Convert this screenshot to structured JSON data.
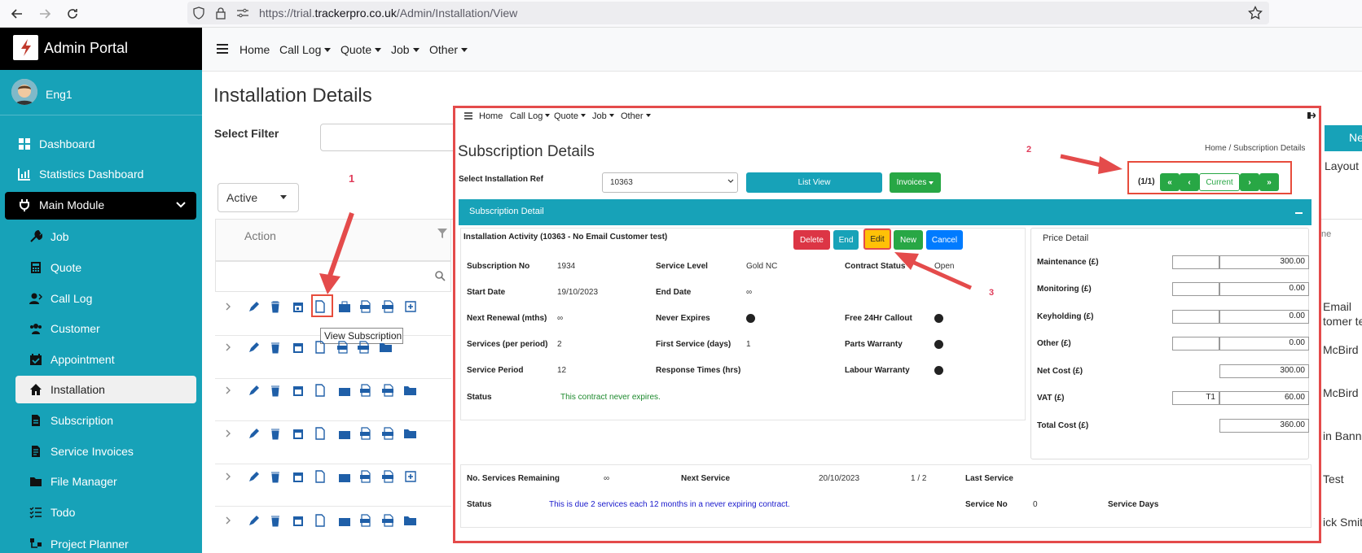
{
  "browser": {
    "url_prefix": "https://trial.",
    "url_domain": "trackerpro.co.uk",
    "url_path": "/Admin/Installation/View"
  },
  "sidebar": {
    "brand": "Admin Portal",
    "user": "Eng1",
    "items": [
      {
        "label": "Dashboard",
        "icon": "dashboard-icon"
      },
      {
        "label": "Statistics Dashboard",
        "icon": "statistics-icon"
      },
      {
        "label": "Main Module",
        "icon": "plug-icon"
      },
      {
        "label": "Job",
        "icon": "wrench-icon"
      },
      {
        "label": "Quote",
        "icon": "calculator-icon"
      },
      {
        "label": "Call Log",
        "icon": "user-phone-icon"
      },
      {
        "label": "Customer",
        "icon": "users-icon"
      },
      {
        "label": "Appointment",
        "icon": "calendar-check-icon"
      },
      {
        "label": "Installation",
        "icon": "home-icon"
      },
      {
        "label": "Subscription",
        "icon": "file-icon"
      },
      {
        "label": "Service Invoices",
        "icon": "invoice-icon"
      },
      {
        "label": "File Manager",
        "icon": "folder-icon"
      },
      {
        "label": "Todo",
        "icon": "list-icon"
      },
      {
        "label": "Project Planner",
        "icon": "planner-icon"
      }
    ]
  },
  "topnav": {
    "home": "Home",
    "call_log": "Call Log",
    "quote": "Quote",
    "job": "Job",
    "other": "Other"
  },
  "page": {
    "title": "Installation Details",
    "filter_label": "Select Filter",
    "active_filter": "Active",
    "action_header": "Action",
    "tooltip": "View Subscription",
    "step1": "1",
    "step2": "2",
    "step3": "3",
    "partial_right": {
      "btn_new": "Ne",
      "layout": "Layout",
      "col_ne": "ne",
      "email": "Email",
      "tomer": "tomer te",
      "mcbird1": "McBird",
      "mcbird2": "McBird",
      "banne": "in Banne",
      "test": "Test",
      "smith": "ick Smith"
    }
  },
  "overlay": {
    "nav": {
      "home": "Home",
      "call_log": "Call Log",
      "quote": "Quote",
      "job": "Job",
      "other": "Other"
    },
    "title": "Subscription Details",
    "breadcrumb": {
      "home": "Home",
      "sep": "/",
      "current": "Subscription Details"
    },
    "select_label": "Select Installation Ref",
    "install_ref": "10363",
    "list_view": "List View",
    "invoices": "Invoices",
    "pager": {
      "count": "(1/1)",
      "current": "Current"
    },
    "panel_title": "Subscription Detail",
    "activity_title": "Installation Activity (10363 - No Email Customer test)",
    "buttons": {
      "delete": "Delete",
      "end": "End",
      "edit": "Edit",
      "new": "New",
      "cancel": "Cancel"
    },
    "fields": {
      "subscription_no_label": "Subscription No",
      "subscription_no": "1934",
      "service_level_label": "Service Level",
      "service_level": "Gold NC",
      "contract_status_label": "Contract Status",
      "contract_status": "Open",
      "start_date_label": "Start Date",
      "start_date": "19/10/2023",
      "end_date_label": "End Date",
      "end_date": "∞",
      "next_renewal_label": "Next Renewal (mths)",
      "next_renewal": "∞",
      "never_expires_label": "Never Expires",
      "free_callout_label": "Free 24Hr Callout",
      "services_label": "Services (per period)",
      "services": "2",
      "first_service_label": "First Service (days)",
      "first_service": "1",
      "parts_warranty_label": "Parts Warranty",
      "service_period_label": "Service Period",
      "service_period": "12",
      "response_times_label": "Response Times (hrs)",
      "labour_warranty_label": "Labour Warranty",
      "status_label": "Status",
      "status": "This contract never expires."
    },
    "price": {
      "title": "Price Detail",
      "rows": [
        {
          "label": "Maintenance (£)",
          "value": "300.00",
          "left": ""
        },
        {
          "label": "Monitoring (£)",
          "value": "0.00",
          "left": ""
        },
        {
          "label": "Keyholding (£)",
          "value": "0.00",
          "left": ""
        },
        {
          "label": "Other (£)",
          "value": "0.00",
          "left": ""
        },
        {
          "label": "Net Cost (£)",
          "value": "300.00"
        },
        {
          "label": "VAT (£)",
          "value": "60.00",
          "left": "T1"
        },
        {
          "label": "Total Cost (£)",
          "value": "360.00"
        }
      ]
    },
    "footer": {
      "remaining_label": "No. Services Remaining",
      "remaining": "∞",
      "next_service_label": "Next Service",
      "next_service": "20/10/2023",
      "fraction": "1 / 2",
      "last_service_label": "Last Service",
      "status_label": "Status",
      "status": "This is due 2 services each 12 months in a never expiring contract.",
      "service_no_label": "Service No",
      "service_no": "0",
      "service_days_label": "Service Days"
    }
  },
  "colors": {
    "teal": "#17a2b8",
    "red": "#dc3545",
    "green": "#28a745",
    "blue": "#007bff",
    "yellow": "#ffc107",
    "annotation": "#e44b4b"
  }
}
